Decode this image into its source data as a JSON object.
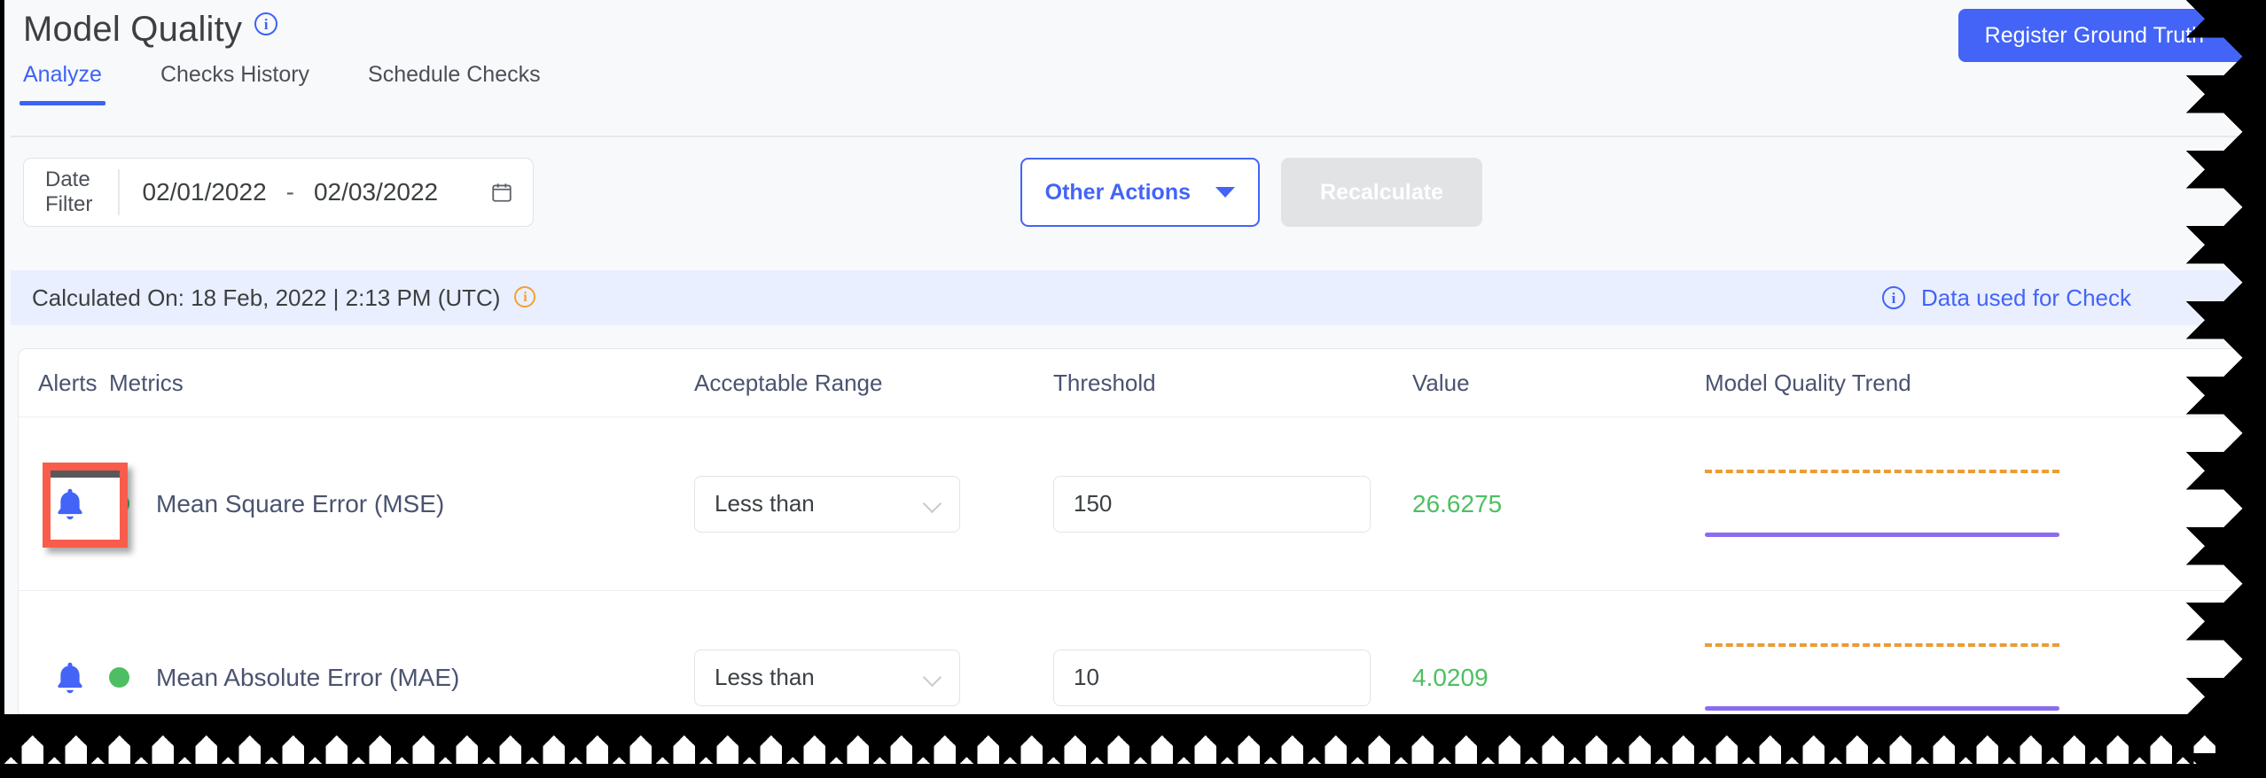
{
  "header": {
    "title": "Model Quality",
    "title_info_icon": "info-icon",
    "tabs": [
      {
        "label": "Analyze",
        "active": true
      },
      {
        "label": "Checks History",
        "active": false
      },
      {
        "label": "Schedule Checks",
        "active": false
      }
    ],
    "register_button": {
      "label": "Register Ground Truth",
      "icon": "chevron-down-icon",
      "color": "#4364f7"
    }
  },
  "filters": {
    "date_filter": {
      "label_line1": "Date",
      "label_line2": "Filter",
      "start_date": "02/01/2022",
      "separator": "-",
      "end_date": "02/03/2022",
      "icon": "calendar-icon"
    },
    "other_actions": {
      "label": "Other Actions",
      "icon": "chevron-down-icon"
    },
    "recalculate": {
      "label": "Recalculate",
      "disabled": true
    }
  },
  "banner": {
    "text": "Calculated On: 18 Feb, 2022 | 2:13 PM (UTC)",
    "info_icon_color": "#f0a22e",
    "link": {
      "label": "Data used for Check",
      "icon": "info-icon",
      "color": "#4364f7"
    },
    "background": "#eaefff"
  },
  "table": {
    "columns": [
      "Alerts",
      "Metrics",
      "Acceptable Range",
      "Threshold",
      "Value",
      "Model Quality Trend"
    ],
    "rows": [
      {
        "alert_icon": "bell-icon",
        "alert_highlighted": true,
        "status_dot_color": "#4dbf62",
        "metric": "Mean Square Error (MSE)",
        "range": "Less than",
        "threshold": "150",
        "value": "26.6275",
        "value_color": "#4dbf62",
        "trend": {
          "threshold_line_color": "#ea9c35",
          "data_line_color": "#8b6cf0"
        }
      },
      {
        "alert_icon": "bell-icon",
        "alert_highlighted": false,
        "status_dot_color": "#4dbf62",
        "metric": "Mean Absolute Error (MAE)",
        "range": "Less than",
        "threshold": "10",
        "value": "4.0209",
        "value_color": "#4dbf62",
        "trend": {
          "threshold_line_color": "#ea9c35",
          "data_line_color": "#8b6cf0"
        }
      }
    ]
  }
}
